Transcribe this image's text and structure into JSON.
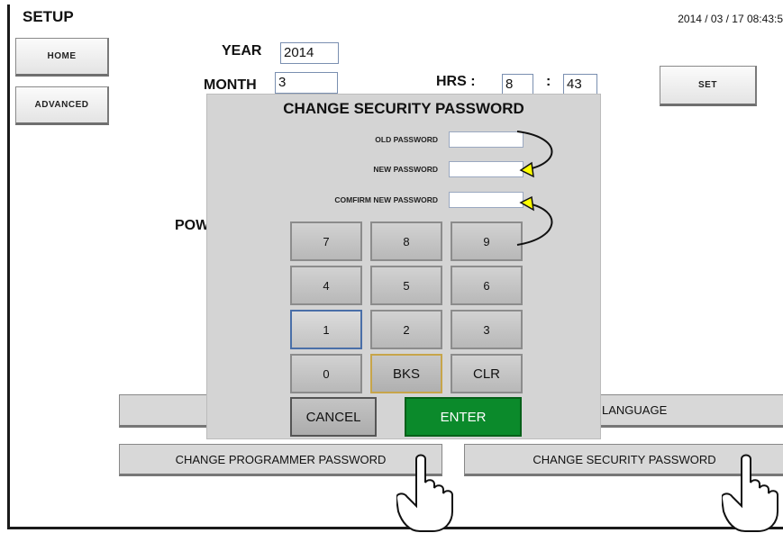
{
  "header": {
    "title": "SETUP",
    "datetime": "2014 / 03 / 17   08:43:5"
  },
  "nav": {
    "home_label": "HOME",
    "advanced_label": "ADVANCED",
    "set_label": "SET"
  },
  "date_time_form": {
    "year_label": "YEAR",
    "year_value": "2014",
    "month_label": "MONTH",
    "month_value": "3",
    "hrs_label": "HRS :",
    "hrs_value": "8",
    "min_separator": ":",
    "min_value": "43",
    "partial_label": "POW"
  },
  "bottom_buttons": {
    "language_label": "LANGUAGE",
    "programmer_label": "CHANGE PROGRAMMER PASSWORD",
    "security_label": "CHANGE SECURITY PASSWORD"
  },
  "dialog": {
    "title": "CHANGE SECURITY PASSWORD",
    "old_label": "OLD PASSWORD",
    "new_label": "NEW PASSWORD",
    "confirm_label": "COMFIRM NEW PASSWORD",
    "keypad": [
      "7",
      "8",
      "9",
      "4",
      "5",
      "6",
      "1",
      "2",
      "3",
      "0",
      "BKS",
      "CLR"
    ],
    "cancel_label": "CANCEL",
    "enter_label": "ENTER"
  },
  "colors": {
    "enter": "#0b8a2b",
    "arrow": "#ffff00",
    "bks_border": "#c7a54a",
    "active_key_border": "#4a6fa8"
  },
  "icons": [
    "pointing-hand-icon",
    "curved-arrow-icon"
  ]
}
